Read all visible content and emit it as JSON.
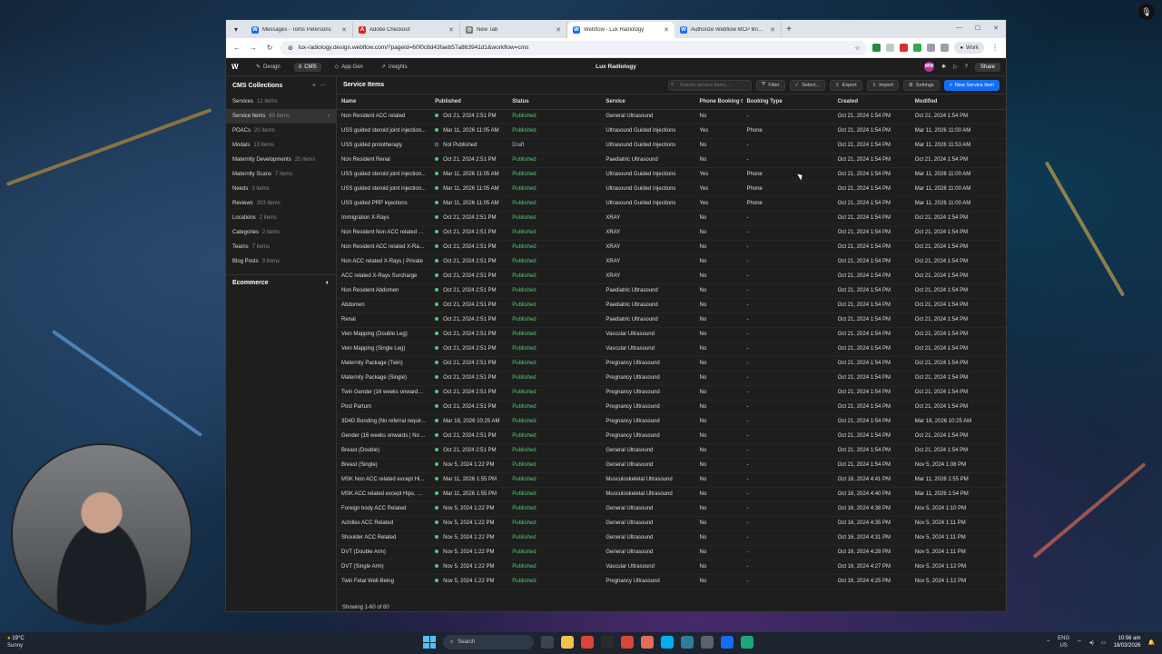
{
  "browser": {
    "tabs": [
      {
        "label": "Messages - Toms Petersons",
        "icon": "webflow-icon",
        "color": "#146ef5"
      },
      {
        "label": "Adobe Checkout",
        "icon": "adobe-icon",
        "color": "#e1251b"
      },
      {
        "label": "New Tab",
        "icon": "chrome-icon",
        "color": "#777777"
      },
      {
        "label": "Webflow - Lux Radiology",
        "icon": "webflow-icon",
        "color": "#146ef5"
      },
      {
        "label": "Authorize Webflow MCP Bridge",
        "icon": "webflow-icon",
        "color": "#146ef5"
      }
    ],
    "url": "lux-radiology.design.webflow.com/?pageId=60f0c8d43faeb57a863941d1&workflow=cms",
    "profile_label": "Work"
  },
  "webflow": {
    "modes": [
      "Design",
      "CMS",
      "App Gen",
      "Insights"
    ],
    "site_name": "Lux Radiology",
    "avatar_initials": "MW",
    "share_label": "Share"
  },
  "sidebar": {
    "title": "CMS Collections",
    "items": [
      {
        "label": "Services",
        "count": "12 items"
      },
      {
        "label": "Service Items",
        "count": "60 items"
      },
      {
        "label": "POACs",
        "count": "20 items"
      },
      {
        "label": "Modals",
        "count": "13 items"
      },
      {
        "label": "Maternity Developments",
        "count": "25 items"
      },
      {
        "label": "Maternity Scans",
        "count": "7 items"
      },
      {
        "label": "Needs",
        "count": "3 items"
      },
      {
        "label": "Reviews",
        "count": "203 items"
      },
      {
        "label": "Locations",
        "count": "2 items"
      },
      {
        "label": "Categories",
        "count": "2 items"
      },
      {
        "label": "Teams",
        "count": "7 items"
      },
      {
        "label": "Blog Posts",
        "count": "3 items"
      }
    ],
    "ecommerce_label": "Ecommerce"
  },
  "main": {
    "title": "Service Items",
    "search_placeholder": "Search service items...",
    "buttons": {
      "filter": "Filter",
      "select": "Select...",
      "export": "Export",
      "import": "Import",
      "settings": "Settings",
      "new_item": "New Service Item"
    },
    "columns": [
      "Name",
      "Published",
      "Status",
      "Service",
      "Phone Booking Only",
      "Booking Type",
      "Created",
      "Modified"
    ],
    "rows": [
      [
        "Non Resident ACC related",
        "Oct 21, 2024 2:51 PM",
        "Published",
        "General Ultrasound",
        "No",
        "-",
        "Oct 21, 2024 1:54 PM",
        "Oct 21, 2024 1:54 PM"
      ],
      [
        "USS guided steroid joint injection...",
        "Mar 11, 2026 11:05 AM",
        "Published",
        "Ultrasound Guided Injections",
        "Yes",
        "Phone",
        "Oct 21, 2024 1:54 PM",
        "Mar 11, 2026 11:00 AM"
      ],
      [
        "USS guided prolotherapy",
        "Not Published",
        "Draft",
        "Ultrasound Guided Injections",
        "No",
        "-",
        "Oct 21, 2024 1:54 PM",
        "Mar 11, 2026 11:53 AM"
      ],
      [
        "Non Resident Renal",
        "Oct 21, 2024 2:51 PM",
        "Published",
        "Paediatric Ultrasound",
        "No",
        "-",
        "Oct 21, 2024 1:54 PM",
        "Oct 21, 2024 1:54 PM"
      ],
      [
        "USS guided steroid joint injection...",
        "Mar 11, 2026 11:05 AM",
        "Published",
        "Ultrasound Guided Injections",
        "Yes",
        "Phone",
        "Oct 21, 2024 1:54 PM",
        "Mar 11, 2026 11:00 AM"
      ],
      [
        "USS guided steroid joint injection...",
        "Mar 11, 2026 11:05 AM",
        "Published",
        "Ultrasound Guided Injections",
        "Yes",
        "Phone",
        "Oct 21, 2024 1:54 PM",
        "Mar 11, 2026 11:00 AM"
      ],
      [
        "USS guided PRP injections",
        "Mar 11, 2026 11:05 AM",
        "Published",
        "Ultrasound Guided Injections",
        "Yes",
        "Phone",
        "Oct 21, 2024 1:54 PM",
        "Mar 11, 2026 11:00 AM"
      ],
      [
        "Immigration X-Rays",
        "Oct 21, 2024 2:51 PM",
        "Published",
        "XRAY",
        "No",
        "-",
        "Oct 21, 2024 1:54 PM",
        "Oct 21, 2024 1:54 PM"
      ],
      [
        "Non Resident Non ACC related X...",
        "Oct 21, 2024 2:51 PM",
        "Published",
        "XRAY",
        "No",
        "-",
        "Oct 21, 2024 1:54 PM",
        "Oct 21, 2024 1:54 PM"
      ],
      [
        "Non Resident ACC related X-Ray...",
        "Oct 21, 2024 2:51 PM",
        "Published",
        "XRAY",
        "No",
        "-",
        "Oct 21, 2024 1:54 PM",
        "Oct 21, 2024 1:54 PM"
      ],
      [
        "Non ACC related X-Rays | Private",
        "Oct 21, 2024 2:51 PM",
        "Published",
        "XRAY",
        "No",
        "-",
        "Oct 21, 2024 1:54 PM",
        "Oct 21, 2024 1:54 PM"
      ],
      [
        "ACC related X-Rays Surcharge",
        "Oct 21, 2024 2:51 PM",
        "Published",
        "XRAY",
        "No",
        "-",
        "Oct 21, 2024 1:54 PM",
        "Oct 21, 2024 1:54 PM"
      ],
      [
        "Non Resident Abdomen",
        "Oct 21, 2024 2:51 PM",
        "Published",
        "Paediatric Ultrasound",
        "No",
        "-",
        "Oct 21, 2024 1:54 PM",
        "Oct 21, 2024 1:54 PM"
      ],
      [
        "Abdomen",
        "Oct 21, 2024 2:51 PM",
        "Published",
        "Paediatric Ultrasound",
        "No",
        "-",
        "Oct 21, 2024 1:54 PM",
        "Oct 21, 2024 1:54 PM"
      ],
      [
        "Renal",
        "Oct 21, 2024 2:51 PM",
        "Published",
        "Paediatric Ultrasound",
        "No",
        "-",
        "Oct 21, 2024 1:54 PM",
        "Oct 21, 2024 1:54 PM"
      ],
      [
        "Vein Mapping (Double Leg)",
        "Oct 21, 2024 2:51 PM",
        "Published",
        "Vascular Ultrasound",
        "No",
        "-",
        "Oct 21, 2024 1:54 PM",
        "Oct 21, 2024 1:54 PM"
      ],
      [
        "Vein Mapping (Single Leg)",
        "Oct 21, 2024 2:51 PM",
        "Published",
        "Vascular Ultrasound",
        "No",
        "-",
        "Oct 21, 2024 1:54 PM",
        "Oct 21, 2024 1:54 PM"
      ],
      [
        "Maternity Package (Twin)",
        "Oct 21, 2024 2:51 PM",
        "Published",
        "Pregnancy Ultrasound",
        "No",
        "-",
        "Oct 21, 2024 1:54 PM",
        "Oct 21, 2024 1:54 PM"
      ],
      [
        "Maternity Package (Single)",
        "Oct 21, 2024 2:51 PM",
        "Published",
        "Pregnancy Ultrasound",
        "No",
        "-",
        "Oct 21, 2024 1:54 PM",
        "Oct 21, 2024 1:54 PM"
      ],
      [
        "Twin Gender (16 weeks onwards ...",
        "Oct 21, 2024 2:51 PM",
        "Published",
        "Pregnancy Ultrasound",
        "No",
        "-",
        "Oct 21, 2024 1:54 PM",
        "Oct 21, 2024 1:54 PM"
      ],
      [
        "Post Partum",
        "Oct 21, 2024 2:51 PM",
        "Published",
        "Pregnancy Ultrasound",
        "No",
        "-",
        "Oct 21, 2024 1:54 PM",
        "Oct 21, 2024 1:54 PM"
      ],
      [
        "3D4D Bonding (No referral requir...",
        "Mar 18, 2026 10:25 AM",
        "Published",
        "Pregnancy Ultrasound",
        "No",
        "-",
        "Oct 21, 2024 1:54 PM",
        "Mar 18, 2026 10:25 AM"
      ],
      [
        "Gender (16 weeks onwards | No ...",
        "Oct 21, 2024 2:51 PM",
        "Published",
        "Pregnancy Ultrasound",
        "No",
        "-",
        "Oct 21, 2024 1:54 PM",
        "Oct 21, 2024 1:54 PM"
      ],
      [
        "Breast (Double)",
        "Oct 21, 2024 2:51 PM",
        "Published",
        "General Ultrasound",
        "No",
        "-",
        "Oct 21, 2024 1:54 PM",
        "Oct 21, 2024 1:54 PM"
      ],
      [
        "Breast (Single)",
        "Nov 5, 2024 1:22 PM",
        "Published",
        "General Ultrasound",
        "No",
        "-",
        "Oct 21, 2024 1:54 PM",
        "Nov 5, 2024 1:08 PM"
      ],
      [
        "MSK Non ACC related except Hi...",
        "Mar 11, 2026 1:55 PM",
        "Published",
        "Musculoskeletal Ultrasound",
        "No",
        "-",
        "Oct 16, 2024 4:41 PM",
        "Mar 11, 2026 1:55 PM"
      ],
      [
        "MSK ACC related except Hips, Gl...",
        "Mar 11, 2026 1:55 PM",
        "Published",
        "Musculoskeletal Ultrasound",
        "No",
        "-",
        "Oct 16, 2024 4:40 PM",
        "Mar 11, 2026 1:54 PM"
      ],
      [
        "Foreign body ACC Related",
        "Nov 5, 2024 1:22 PM",
        "Published",
        "General Ultrasound",
        "No",
        "-",
        "Oct 16, 2024 4:38 PM",
        "Nov 5, 2024 1:10 PM"
      ],
      [
        "Achilles ACC Related",
        "Nov 5, 2024 1:22 PM",
        "Published",
        "General Ultrasound",
        "No",
        "-",
        "Oct 16, 2024 4:35 PM",
        "Nov 5, 2024 1:11 PM"
      ],
      [
        "Shoulder ACC Related",
        "Nov 5, 2024 1:22 PM",
        "Published",
        "General Ultrasound",
        "No",
        "-",
        "Oct 16, 2024 4:31 PM",
        "Nov 5, 2024 1:11 PM"
      ],
      [
        "DVT (Double Arm)",
        "Nov 5, 2024 1:22 PM",
        "Published",
        "General Ultrasound",
        "No",
        "-",
        "Oct 16, 2024 4:28 PM",
        "Nov 5, 2024 1:11 PM"
      ],
      [
        "DVT (Single Arm)",
        "Nov 5, 2024 1:22 PM",
        "Published",
        "Vascular Ultrasound",
        "No",
        "-",
        "Oct 16, 2024 4:27 PM",
        "Nov 5, 2024 1:12 PM"
      ],
      [
        "Twin Fetal Well-Being",
        "Nov 5, 2024 1:22 PM",
        "Published",
        "Pregnancy Ultrasound",
        "No",
        "-",
        "Oct 16, 2024 4:25 PM",
        "Nov 5, 2024 1:12 PM"
      ]
    ],
    "footer": "Showing 1-60 of 60"
  },
  "taskbar": {
    "temperature": "19°C",
    "weather": "Sunny",
    "search_label": "Search",
    "lang": "ENG",
    "region": "US",
    "time": "10:56 am",
    "date": "18/03/2026"
  },
  "colors": {
    "accent": "#146ef5",
    "published": "#4ecb71"
  }
}
